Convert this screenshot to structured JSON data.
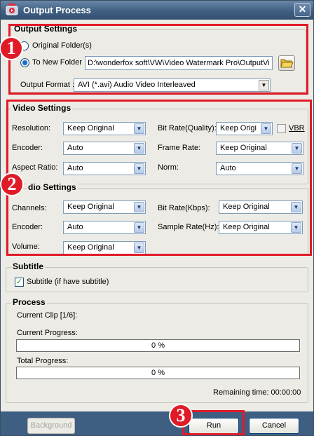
{
  "window": {
    "title": "Output Process",
    "close_glyph": "✕"
  },
  "output_settings": {
    "title": "Output Settings",
    "original_folder_label": "Original Folder(s)",
    "new_folder_label": "To New Folder",
    "new_folder_path": "D:\\wonderfox soft\\VW\\Video Watermark Pro\\OutputVi",
    "output_format_label": "Output Format :",
    "output_format_value": "AVI  (*.avi) Audio Video Interleaved"
  },
  "video_settings": {
    "title": "Video Settings",
    "resolution_label": "Resolution:",
    "resolution_value": "Keep Original",
    "encoder_label": "Encoder:",
    "encoder_value": "Auto",
    "aspect_label": "Aspect Ratio:",
    "aspect_value": "Auto",
    "bitrate_label": "Bit Rate(Quality):",
    "bitrate_value": "Keep Origi",
    "vbr_label": "VBR",
    "framerate_label": "Frame Rate:",
    "framerate_value": "Keep Original",
    "norm_label": "Norm:",
    "norm_value": "Auto"
  },
  "audio_settings": {
    "title": "dio Settings",
    "channels_label": "Channels:",
    "channels_value": "Keep Original",
    "encoder_label": "Encoder:",
    "encoder_value": "Auto",
    "volume_label": "Volume:",
    "volume_value": "Keep Original",
    "bitrate_label": "Bit Rate(Kbps):",
    "bitrate_value": "Keep Original",
    "samplerate_label": "Sample Rate(Hz):",
    "samplerate_value": "Keep Original"
  },
  "subtitle": {
    "title": "Subtitle",
    "checkbox_label": "Subtitle (if have subtitle)",
    "check_glyph": "✓"
  },
  "process": {
    "title": "Process",
    "current_clip": "Current Clip [1/6]:",
    "current_progress_label": "Current Progress:",
    "current_progress_text": "0 %",
    "current_progress": 0,
    "total_progress_label": "Total Progress:",
    "total_progress_text": "0 %",
    "total_progress": 0,
    "remaining_time": "Remaining time: 00:00:00"
  },
  "buttons": {
    "background": "Background",
    "run": "Run",
    "cancel": "Cancel"
  },
  "annotations": {
    "badge_1": "1",
    "badge_2": "2",
    "badge_3": "3"
  },
  "colors": {
    "annotation_red": "#e11a28",
    "titlebar": "#3f5f82"
  },
  "icons": {
    "app": "app-icon",
    "close": "close-icon",
    "folder": "folder-icon",
    "dropdown": "chevron-down-icon"
  }
}
